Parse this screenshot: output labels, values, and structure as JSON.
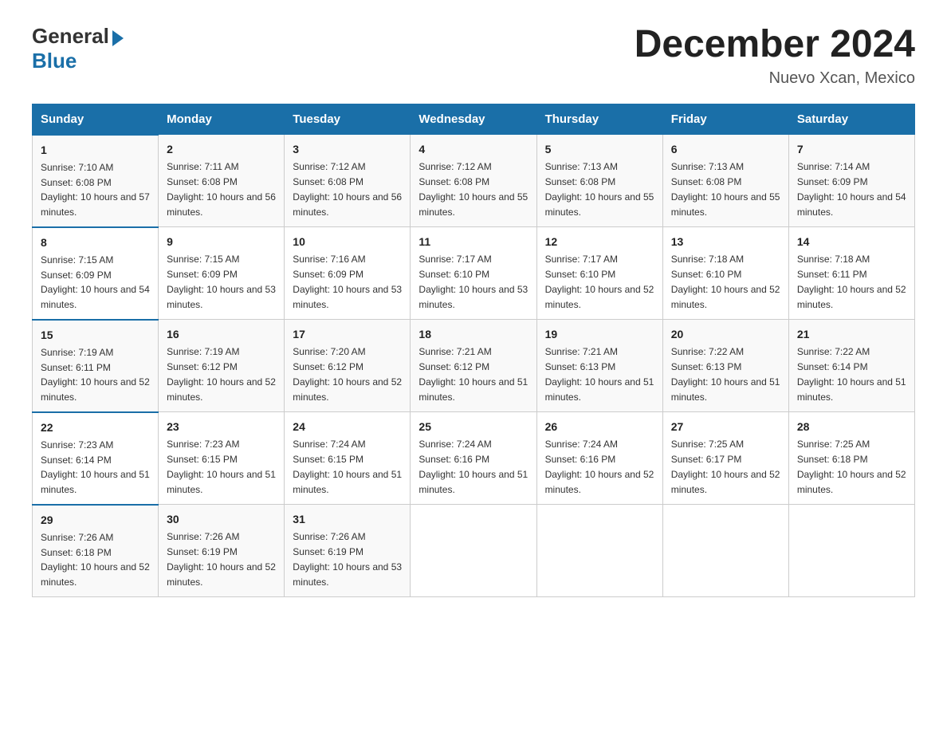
{
  "header": {
    "logo_general": "General",
    "logo_blue": "Blue",
    "month_year": "December 2024",
    "location": "Nuevo Xcan, Mexico"
  },
  "days_of_week": [
    "Sunday",
    "Monday",
    "Tuesday",
    "Wednesday",
    "Thursday",
    "Friday",
    "Saturday"
  ],
  "weeks": [
    [
      {
        "day": "1",
        "sunrise": "7:10 AM",
        "sunset": "6:08 PM",
        "daylight": "10 hours and 57 minutes."
      },
      {
        "day": "2",
        "sunrise": "7:11 AM",
        "sunset": "6:08 PM",
        "daylight": "10 hours and 56 minutes."
      },
      {
        "day": "3",
        "sunrise": "7:12 AM",
        "sunset": "6:08 PM",
        "daylight": "10 hours and 56 minutes."
      },
      {
        "day": "4",
        "sunrise": "7:12 AM",
        "sunset": "6:08 PM",
        "daylight": "10 hours and 55 minutes."
      },
      {
        "day": "5",
        "sunrise": "7:13 AM",
        "sunset": "6:08 PM",
        "daylight": "10 hours and 55 minutes."
      },
      {
        "day": "6",
        "sunrise": "7:13 AM",
        "sunset": "6:08 PM",
        "daylight": "10 hours and 55 minutes."
      },
      {
        "day": "7",
        "sunrise": "7:14 AM",
        "sunset": "6:09 PM",
        "daylight": "10 hours and 54 minutes."
      }
    ],
    [
      {
        "day": "8",
        "sunrise": "7:15 AM",
        "sunset": "6:09 PM",
        "daylight": "10 hours and 54 minutes."
      },
      {
        "day": "9",
        "sunrise": "7:15 AM",
        "sunset": "6:09 PM",
        "daylight": "10 hours and 53 minutes."
      },
      {
        "day": "10",
        "sunrise": "7:16 AM",
        "sunset": "6:09 PM",
        "daylight": "10 hours and 53 minutes."
      },
      {
        "day": "11",
        "sunrise": "7:17 AM",
        "sunset": "6:10 PM",
        "daylight": "10 hours and 53 minutes."
      },
      {
        "day": "12",
        "sunrise": "7:17 AM",
        "sunset": "6:10 PM",
        "daylight": "10 hours and 52 minutes."
      },
      {
        "day": "13",
        "sunrise": "7:18 AM",
        "sunset": "6:10 PM",
        "daylight": "10 hours and 52 minutes."
      },
      {
        "day": "14",
        "sunrise": "7:18 AM",
        "sunset": "6:11 PM",
        "daylight": "10 hours and 52 minutes."
      }
    ],
    [
      {
        "day": "15",
        "sunrise": "7:19 AM",
        "sunset": "6:11 PM",
        "daylight": "10 hours and 52 minutes."
      },
      {
        "day": "16",
        "sunrise": "7:19 AM",
        "sunset": "6:12 PM",
        "daylight": "10 hours and 52 minutes."
      },
      {
        "day": "17",
        "sunrise": "7:20 AM",
        "sunset": "6:12 PM",
        "daylight": "10 hours and 52 minutes."
      },
      {
        "day": "18",
        "sunrise": "7:21 AM",
        "sunset": "6:12 PM",
        "daylight": "10 hours and 51 minutes."
      },
      {
        "day": "19",
        "sunrise": "7:21 AM",
        "sunset": "6:13 PM",
        "daylight": "10 hours and 51 minutes."
      },
      {
        "day": "20",
        "sunrise": "7:22 AM",
        "sunset": "6:13 PM",
        "daylight": "10 hours and 51 minutes."
      },
      {
        "day": "21",
        "sunrise": "7:22 AM",
        "sunset": "6:14 PM",
        "daylight": "10 hours and 51 minutes."
      }
    ],
    [
      {
        "day": "22",
        "sunrise": "7:23 AM",
        "sunset": "6:14 PM",
        "daylight": "10 hours and 51 minutes."
      },
      {
        "day": "23",
        "sunrise": "7:23 AM",
        "sunset": "6:15 PM",
        "daylight": "10 hours and 51 minutes."
      },
      {
        "day": "24",
        "sunrise": "7:24 AM",
        "sunset": "6:15 PM",
        "daylight": "10 hours and 51 minutes."
      },
      {
        "day": "25",
        "sunrise": "7:24 AM",
        "sunset": "6:16 PM",
        "daylight": "10 hours and 51 minutes."
      },
      {
        "day": "26",
        "sunrise": "7:24 AM",
        "sunset": "6:16 PM",
        "daylight": "10 hours and 52 minutes."
      },
      {
        "day": "27",
        "sunrise": "7:25 AM",
        "sunset": "6:17 PM",
        "daylight": "10 hours and 52 minutes."
      },
      {
        "day": "28",
        "sunrise": "7:25 AM",
        "sunset": "6:18 PM",
        "daylight": "10 hours and 52 minutes."
      }
    ],
    [
      {
        "day": "29",
        "sunrise": "7:26 AM",
        "sunset": "6:18 PM",
        "daylight": "10 hours and 52 minutes."
      },
      {
        "day": "30",
        "sunrise": "7:26 AM",
        "sunset": "6:19 PM",
        "daylight": "10 hours and 52 minutes."
      },
      {
        "day": "31",
        "sunrise": "7:26 AM",
        "sunset": "6:19 PM",
        "daylight": "10 hours and 53 minutes."
      },
      null,
      null,
      null,
      null
    ]
  ]
}
